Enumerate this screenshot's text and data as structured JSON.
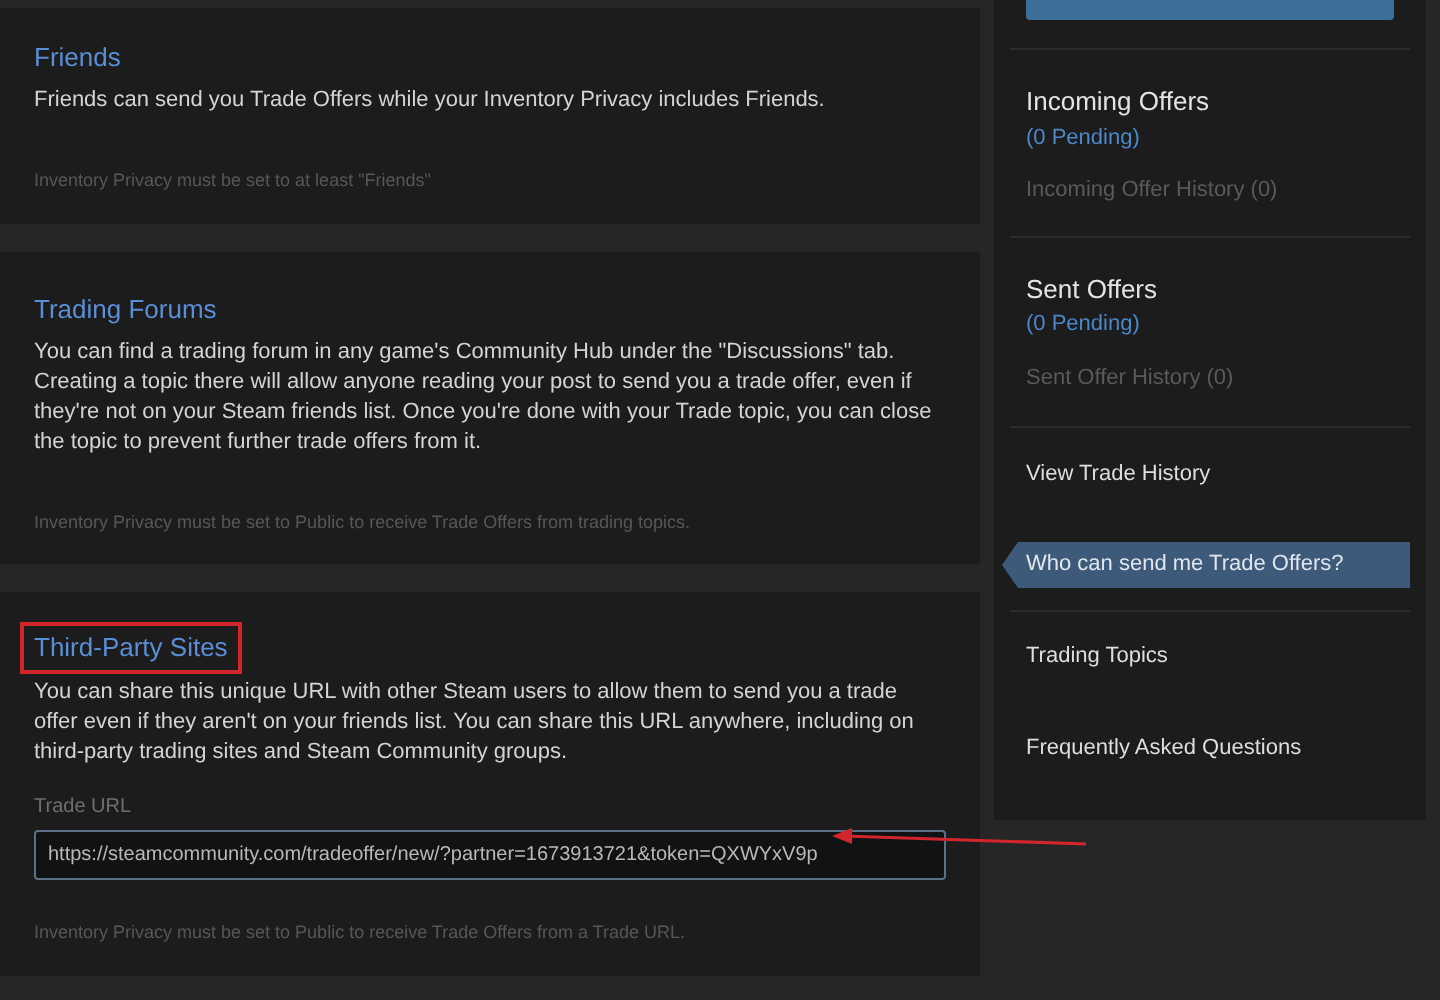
{
  "sections": [
    {
      "title": "Friends",
      "body": "Friends can send you Trade Offers while your Inventory Privacy includes Friends.",
      "note": "Inventory Privacy must be set to at least \"Friends\"",
      "highlighted": false
    },
    {
      "title": "Trading Forums",
      "body": "You can find a trading forum in any game's Community Hub under the \"Discussions\" tab. Creating a topic there will allow anyone reading your post to send you a trade offer, even if they're not on your Steam friends list. Once you're done with your Trade topic, you can close the topic to prevent further trade offers from it.",
      "note": "Inventory Privacy must be set to Public to receive Trade Offers from trading topics.",
      "highlighted": false
    },
    {
      "title": "Third-Party Sites",
      "body": "You can share this unique URL with other Steam users to allow them to send you a trade offer even if they aren't on your friends list. You can share this URL anywhere, including on third-party trading sites and Steam Community groups.",
      "field": {
        "label": "Trade URL",
        "value": "https://steamcommunity.com/tradeoffer/new/?partner=1673913721&token=QXWYxV9p",
        "annotated": true
      },
      "note": "Inventory Privacy must be set to Public to receive Trade Offers from a Trade URL.",
      "highlighted": true
    }
  ],
  "sidebar": {
    "offer_groups": [
      {
        "title": "Incoming Offers",
        "pending": "(0 Pending)",
        "history": "Incoming Offer History (0)"
      },
      {
        "title": "Sent Offers",
        "pending": "(0 Pending)",
        "history": "Sent Offer History (0)"
      }
    ],
    "links": [
      {
        "label": "View Trade History",
        "selected": false
      },
      {
        "label": "Who can send me Trade Offers?",
        "selected": true
      },
      {
        "label": "Trading Topics",
        "selected": false
      },
      {
        "label": "Frequently Asked Questions",
        "selected": false
      }
    ]
  }
}
